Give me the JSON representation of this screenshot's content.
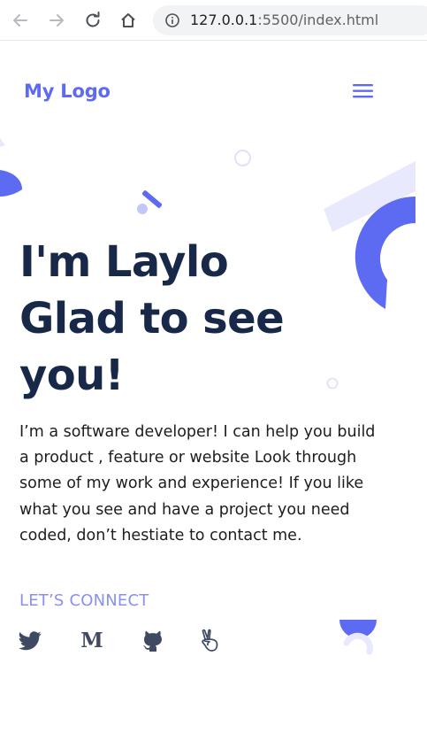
{
  "browser": {
    "url_host": "127.0.0.1",
    "url_path": ":5500/index.html"
  },
  "header": {
    "logo": "My Logo",
    "menu_icon": "hamburger-menu-icon"
  },
  "hero": {
    "title_lines": [
      "I'm Laylo",
      "Glad to see",
      "you!"
    ],
    "description": "I’m a software developer! I can help you build a product , feature or website Look through some of my work and experience! If you like what you see and have a project you need coded, don’t hestiate to contact me.",
    "connect_label": "LET’S CONNECT"
  },
  "social": [
    {
      "icon": "twitter-icon"
    },
    {
      "icon": "medium-icon",
      "glyph": "M"
    },
    {
      "icon": "github-icon"
    },
    {
      "icon": "angellist-icon"
    }
  ],
  "colors": {
    "accent": "#5c6bf2",
    "accent_light": "#e8e9fd",
    "heading": "#182848",
    "connect": "#8a90f0"
  }
}
